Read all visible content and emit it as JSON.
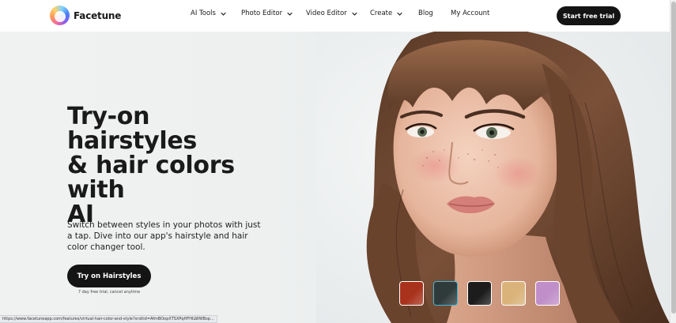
{
  "brand": {
    "name": "Facetune"
  },
  "nav": {
    "items": [
      {
        "label": "AI Tools",
        "has_dropdown": true
      },
      {
        "label": "Photo Editor",
        "has_dropdown": true
      },
      {
        "label": "Video Editor",
        "has_dropdown": true
      },
      {
        "label": "Create",
        "has_dropdown": true
      },
      {
        "label": "Blog",
        "has_dropdown": false
      },
      {
        "label": "My Account",
        "has_dropdown": false
      }
    ],
    "cta_label": "Start free trial"
  },
  "hero": {
    "title_line1": "Try-on hairstyles",
    "title_line2": "& hair colors with",
    "title_line3": "AI",
    "subtitle": "Switch between styles in your photos with just a tap. Dive into our app's hairstyle and hair color changer tool.",
    "button_label": "Try on Hairstyles",
    "trial_note": "7 day free trial, cancel anytime"
  },
  "swatches": [
    {
      "name": "copper-red",
      "color": "#a8321c",
      "selected": false
    },
    {
      "name": "dark-teal",
      "color": "#2f3a3b",
      "selected": true
    },
    {
      "name": "black",
      "color": "#1c1c1c",
      "selected": false
    },
    {
      "name": "blonde",
      "color": "#d9b37a",
      "selected": false
    },
    {
      "name": "lilac",
      "color": "#c08fc9",
      "selected": false
    }
  ],
  "status_bar": {
    "url": "https://www.facetuneapp.com/features/virtual-hair-color-and-style?srsltid=AfmBOopXTSXPqHFHILWWBsp..."
  },
  "colors": {
    "primary_button": "#141414",
    "hero_background": "#eef0f0",
    "selected_swatch_ring": "#3fb6d8"
  }
}
